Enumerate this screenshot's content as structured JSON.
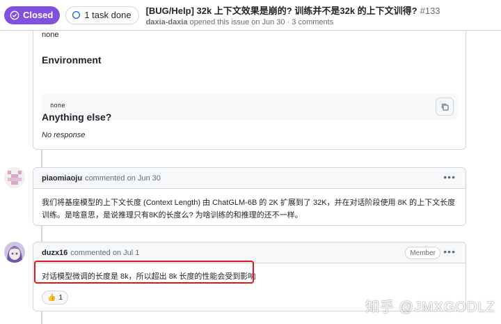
{
  "header": {
    "state": "Closed",
    "tasks": "1 task done",
    "title": "[BUG/Help] 32k 上下文效果是崩的? 训练并不是32k 的上下文训得?",
    "number": "#133",
    "author": "daxia-daxia",
    "meta_text": "opened this issue on Jun 30 · 3 comments"
  },
  "issue_body": {
    "top_text": "none",
    "environment_heading": "Environment",
    "environment_code": "none",
    "anything_heading": "Anything else?",
    "anything_text": "No response"
  },
  "comments": [
    {
      "author": "piaomiaoju",
      "meta": "commented on Jun 30",
      "body": "我们将基座模型的上下文长度 (Context Length) 由 ChatGLM-6B 的 2K 扩展到了 32K，并在对话阶段使用 8K 的上下文长度训练。是啥意思，是说推理只有8K的长度么? 为啥训练的和推理的还不一样。"
    },
    {
      "author": "duzx16",
      "meta": "commented on Jul 1",
      "badge": "Member",
      "body": "对话模型微调的长度是 8k，所以超出 8k 长度的性能会受到影响",
      "reaction_emoji": "👍",
      "reaction_count": "1"
    }
  ],
  "watermark": "知乎 @JMXGODLZ",
  "colors": {
    "closed": "#8250df",
    "highlight": "#e5161b",
    "border": "#d0d7de"
  }
}
